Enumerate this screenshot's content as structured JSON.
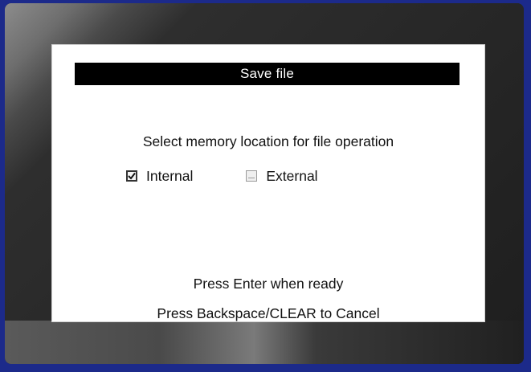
{
  "dialog": {
    "title": "Save file",
    "prompt": "Select memory location for file operation",
    "options": [
      {
        "label": "Internal",
        "checked": true
      },
      {
        "label": "External",
        "checked": false
      }
    ],
    "enter_hint": "Press Enter when ready",
    "cancel_hint": "Press Backspace/CLEAR to Cancel"
  },
  "icons": {
    "checked": "checkbox-checked-icon",
    "unchecked": "checkbox-unchecked-icon"
  },
  "colors": {
    "title_bar": "#000000",
    "screen": "#ffffff",
    "outer": "#1c2a8a"
  }
}
